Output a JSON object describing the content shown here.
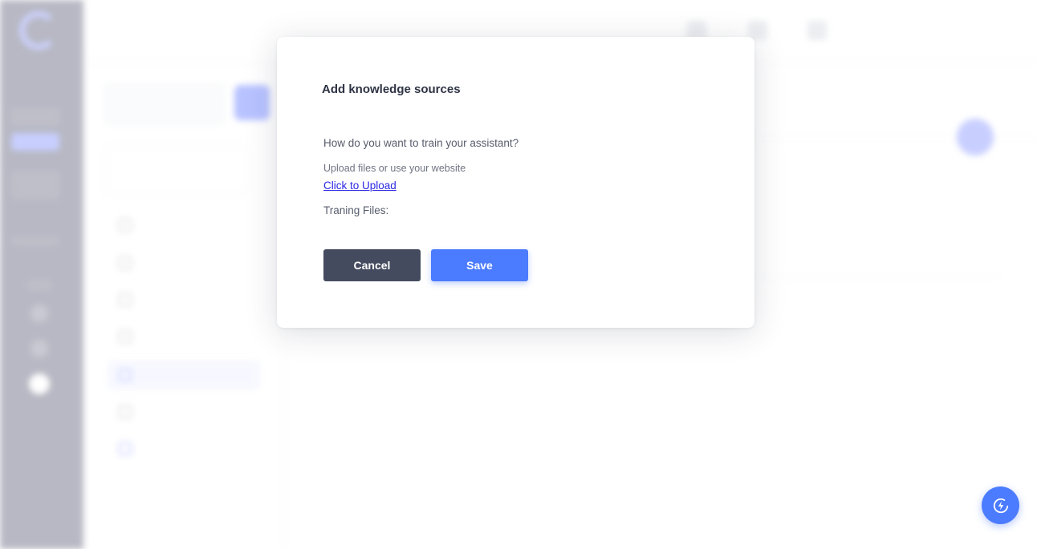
{
  "modal": {
    "title": "Add knowledge sources",
    "question": "How do you want to train your assistant?",
    "hint": "Upload files or use your website",
    "upload_link": "Click to Upload",
    "files_label": "Traning Files:",
    "cancel_label": "Cancel",
    "save_label": "Save"
  },
  "fab": {
    "icon": "lightning-bolt-icon"
  },
  "colors": {
    "primary": "#4b7bff",
    "cancel": "#454b5f",
    "link": "#2b27e3",
    "rail": "#6d6f86"
  }
}
